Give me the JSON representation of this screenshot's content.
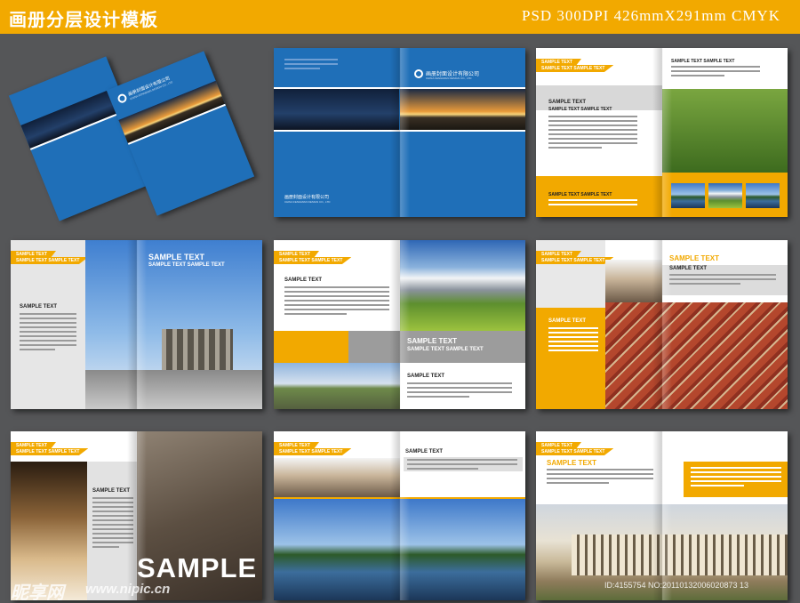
{
  "header": {
    "title": "画册分层设计模板",
    "spec": "PSD 300DPI  426mmX291mm  CMYK"
  },
  "colors": {
    "accent": "#f2a900",
    "blue": "#1f6fb8",
    "background": "#555658"
  },
  "spread1": {
    "company_cn": "画册封面设计有限公司",
    "company_en": "CHINA FENGMIAN DESIGN CO., LTD"
  },
  "spread2": {
    "company_cn": "画册封面设计有限公司",
    "company_en": "CHINA FENGMIAN DESIGN CO., LTD"
  },
  "spread3": {
    "tag1": "SAMPLE TEXT",
    "tag2": "SAMPLE TEXT SAMPLE TEXT",
    "heading": "SAMPLE TEXT",
    "subheading": "SAMPLE TEXT SAMPLE TEXT",
    "right_heading": "SAMPLE TEXT SAMPLE TEXT",
    "bottom_heading": "SAMPLE TEXT SAMPLE TEXT"
  },
  "spread4": {
    "tag1": "SAMPLE TEXT",
    "tag2": "SAMPLE TEXT SAMPLE TEXT",
    "left_heading": "SAMPLE TEXT",
    "big_title": "SAMPLE TEXT",
    "big_subtitle": "SAMPLE TEXT SAMPLE TEXT"
  },
  "spread5": {
    "tag1": "SAMPLE TEXT",
    "tag2": "SAMPLE TEXT SAMPLE TEXT",
    "heading": "SAMPLE TEXT",
    "banner_title": "SAMPLE TEXT",
    "banner_subtitle": "SAMPLE TEXT SAMPLE TEXT",
    "right_heading": "SAMPLE TEXT"
  },
  "spread6": {
    "tag1": "SAMPLE TEXT",
    "tag2": "SAMPLE TEXT SAMPLE TEXT",
    "left_heading": "SAMPLE TEXT",
    "title": "SAMPLE TEXT",
    "subheading": "SAMPLE TEXT"
  },
  "spread7": {
    "tag1": "SAMPLE TEXT",
    "tag2": "SAMPLE TEXT SAMPLE TEXT",
    "heading": "SAMPLE TEXT",
    "big_word": "SAMPLE"
  },
  "spread8": {
    "tag1": "SAMPLE TEXT",
    "tag2": "SAMPLE TEXT SAMPLE TEXT",
    "heading": "SAMPLE TEXT"
  },
  "spread9": {
    "tag1": "SAMPLE TEXT",
    "tag2": "SAMPLE TEXT SAMPLE TEXT",
    "title": "SAMPLE TEXT"
  },
  "footer": {
    "watermark": "昵享网",
    "watermark_url": "www.nipic.cn",
    "image_id": "ID:4155754 NO:20110132006020873 13"
  }
}
